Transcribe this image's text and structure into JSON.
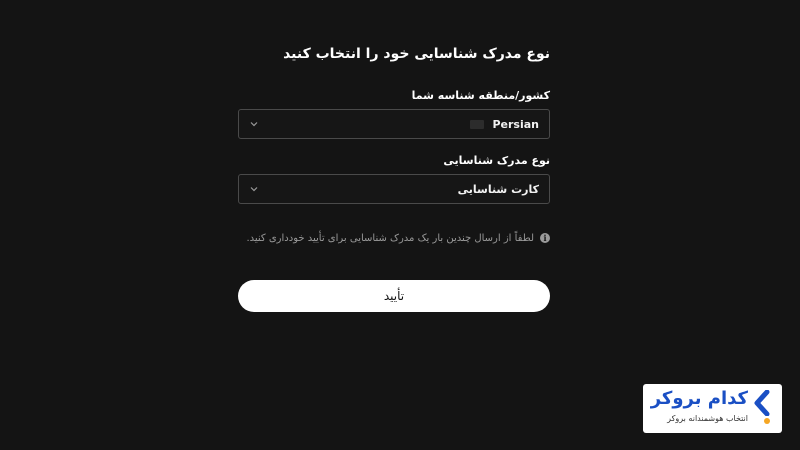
{
  "page": {
    "title": "نوع مدرک شناسایی خود را انتخاب کنید"
  },
  "country": {
    "label": "کشور/منطقه شناسه شما",
    "value": "Persian"
  },
  "document_type": {
    "label": "نوع مدرک شناسایی",
    "value": "کارت شناسایی"
  },
  "notice": {
    "text": "لطفاً از ارسال چندین بار یک مدرک شناسایی برای تأیید خودداری کنید."
  },
  "submit": {
    "label": "تأیید"
  },
  "brand": {
    "name": "کدام بروکر",
    "tagline": "انتخاب هوشمندانه بروکر",
    "colors": {
      "primary": "#1a4fc4",
      "accent": "#f5a623"
    }
  },
  "icons": {
    "chevron": "chevron-down-icon",
    "info": "info-icon",
    "flag": "flag-icon"
  }
}
